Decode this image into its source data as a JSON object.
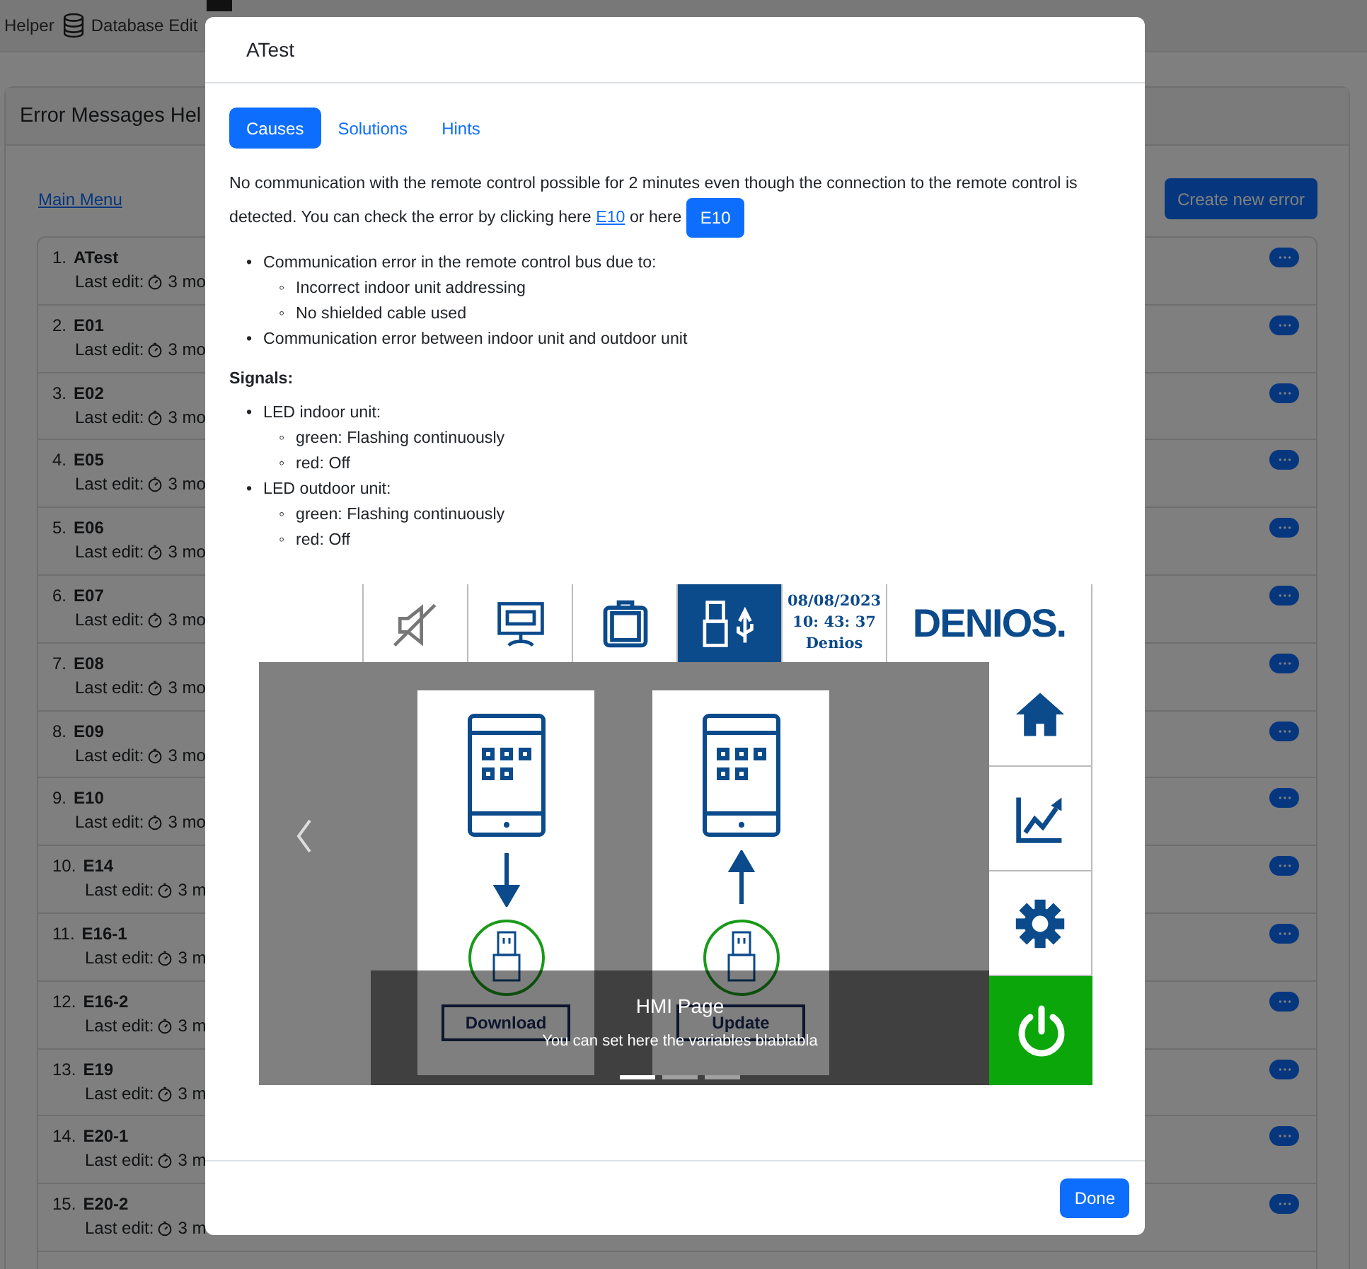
{
  "nav": {
    "items": [
      {
        "label": "Helper",
        "kind": "text"
      },
      {
        "label": "Database Edit",
        "kind": "database"
      }
    ]
  },
  "panel": {
    "title": "Error Messages Hel",
    "main_menu_link": "Main Menu",
    "create_button": "Create new error",
    "errors": [
      {
        "number": "1.",
        "name": "ATest",
        "last_edit": "Last edit:",
        "age": "3 mo"
      },
      {
        "number": "2.",
        "name": "E01",
        "last_edit": "Last edit:",
        "age": "3 mo"
      },
      {
        "number": "3.",
        "name": "E02",
        "last_edit": "Last edit:",
        "age": "3 mo"
      },
      {
        "number": "4.",
        "name": "E05",
        "last_edit": "Last edit:",
        "age": "3 mo"
      },
      {
        "number": "5.",
        "name": "E06",
        "last_edit": "Last edit:",
        "age": "3 mo"
      },
      {
        "number": "6.",
        "name": "E07",
        "last_edit": "Last edit:",
        "age": "3 mo"
      },
      {
        "number": "7.",
        "name": "E08",
        "last_edit": "Last edit:",
        "age": "3 mo"
      },
      {
        "number": "8.",
        "name": "E09",
        "last_edit": "Last edit:",
        "age": "3 mo"
      },
      {
        "number": "9.",
        "name": "E10",
        "last_edit": "Last edit:",
        "age": "3 mo"
      },
      {
        "number": "10.",
        "name": "E14",
        "last_edit": "Last edit:",
        "age": "3 m"
      },
      {
        "number": "11.",
        "name": "E16-1",
        "last_edit": "Last edit:",
        "age": "3 m"
      },
      {
        "number": "12.",
        "name": "E16-2",
        "last_edit": "Last edit:",
        "age": "3 m"
      },
      {
        "number": "13.",
        "name": "E19",
        "last_edit": "Last edit:",
        "age": "3 m"
      },
      {
        "number": "14.",
        "name": "E20-1",
        "last_edit": "Last edit:",
        "age": "3 m"
      },
      {
        "number": "15.",
        "name": "E20-2",
        "last_edit": "Last edit:",
        "age": "3 m"
      }
    ]
  },
  "modal": {
    "title": "ATest",
    "tabs": [
      {
        "label": "Causes",
        "selected": true
      },
      {
        "label": "Solutions",
        "selected": false
      },
      {
        "label": "Hints",
        "selected": false
      }
    ],
    "description": {
      "text_before": "No communication with the remote control possible for 2 minutes even though the connection to the remote control is detected. You can check the error by clicking here",
      "link": "E10",
      "text_middle": "or here",
      "button": "E10"
    },
    "causes": [
      {
        "marker": "•",
        "text": "Communication error in the remote control bus due to:",
        "children": [
          {
            "marker": "◦",
            "text": "Incorrect indoor unit addressing"
          },
          {
            "marker": "◦",
            "text": "No shielded cable used"
          }
        ]
      },
      {
        "marker": "•",
        "text": "Communication error between indoor unit and outdoor unit"
      }
    ],
    "signals_heading": "Signals:",
    "signals": [
      {
        "marker": "•",
        "text": "LED indoor unit:",
        "children": [
          {
            "marker": "◦",
            "text": "green: Flashing continuously"
          },
          {
            "marker": "◦",
            "text": "red: Off"
          }
        ]
      },
      {
        "marker": "•",
        "text": "LED outdoor unit:",
        "children": [
          {
            "marker": "◦",
            "text": "green: Flashing continuously"
          },
          {
            "marker": "◦",
            "text": "red: Off"
          }
        ]
      }
    ],
    "carousel": {
      "hmi": {
        "toolbar": [
          {
            "kind": "mute",
            "selected": false
          },
          {
            "kind": "monitor",
            "selected": false
          },
          {
            "kind": "clipboard",
            "selected": false
          },
          {
            "kind": "usb",
            "selected": true
          }
        ],
        "date": "08/08/2023",
        "time": "10: 43: 37",
        "user": "Denios",
        "logo": "DENIOS.",
        "cards": [
          {
            "kind": "download",
            "label": "Download"
          },
          {
            "kind": "update",
            "label": "Update"
          }
        ],
        "side": [
          {
            "kind": "home"
          },
          {
            "kind": "chart"
          },
          {
            "kind": "gear"
          },
          {
            "kind": "power"
          }
        ]
      },
      "caption": {
        "title": "HMI Page",
        "text": "You can set here the variables blablabla"
      },
      "indicators": [
        {
          "selected": true
        },
        {
          "selected": false
        },
        {
          "selected": false
        }
      ]
    },
    "done_button": "Done"
  }
}
